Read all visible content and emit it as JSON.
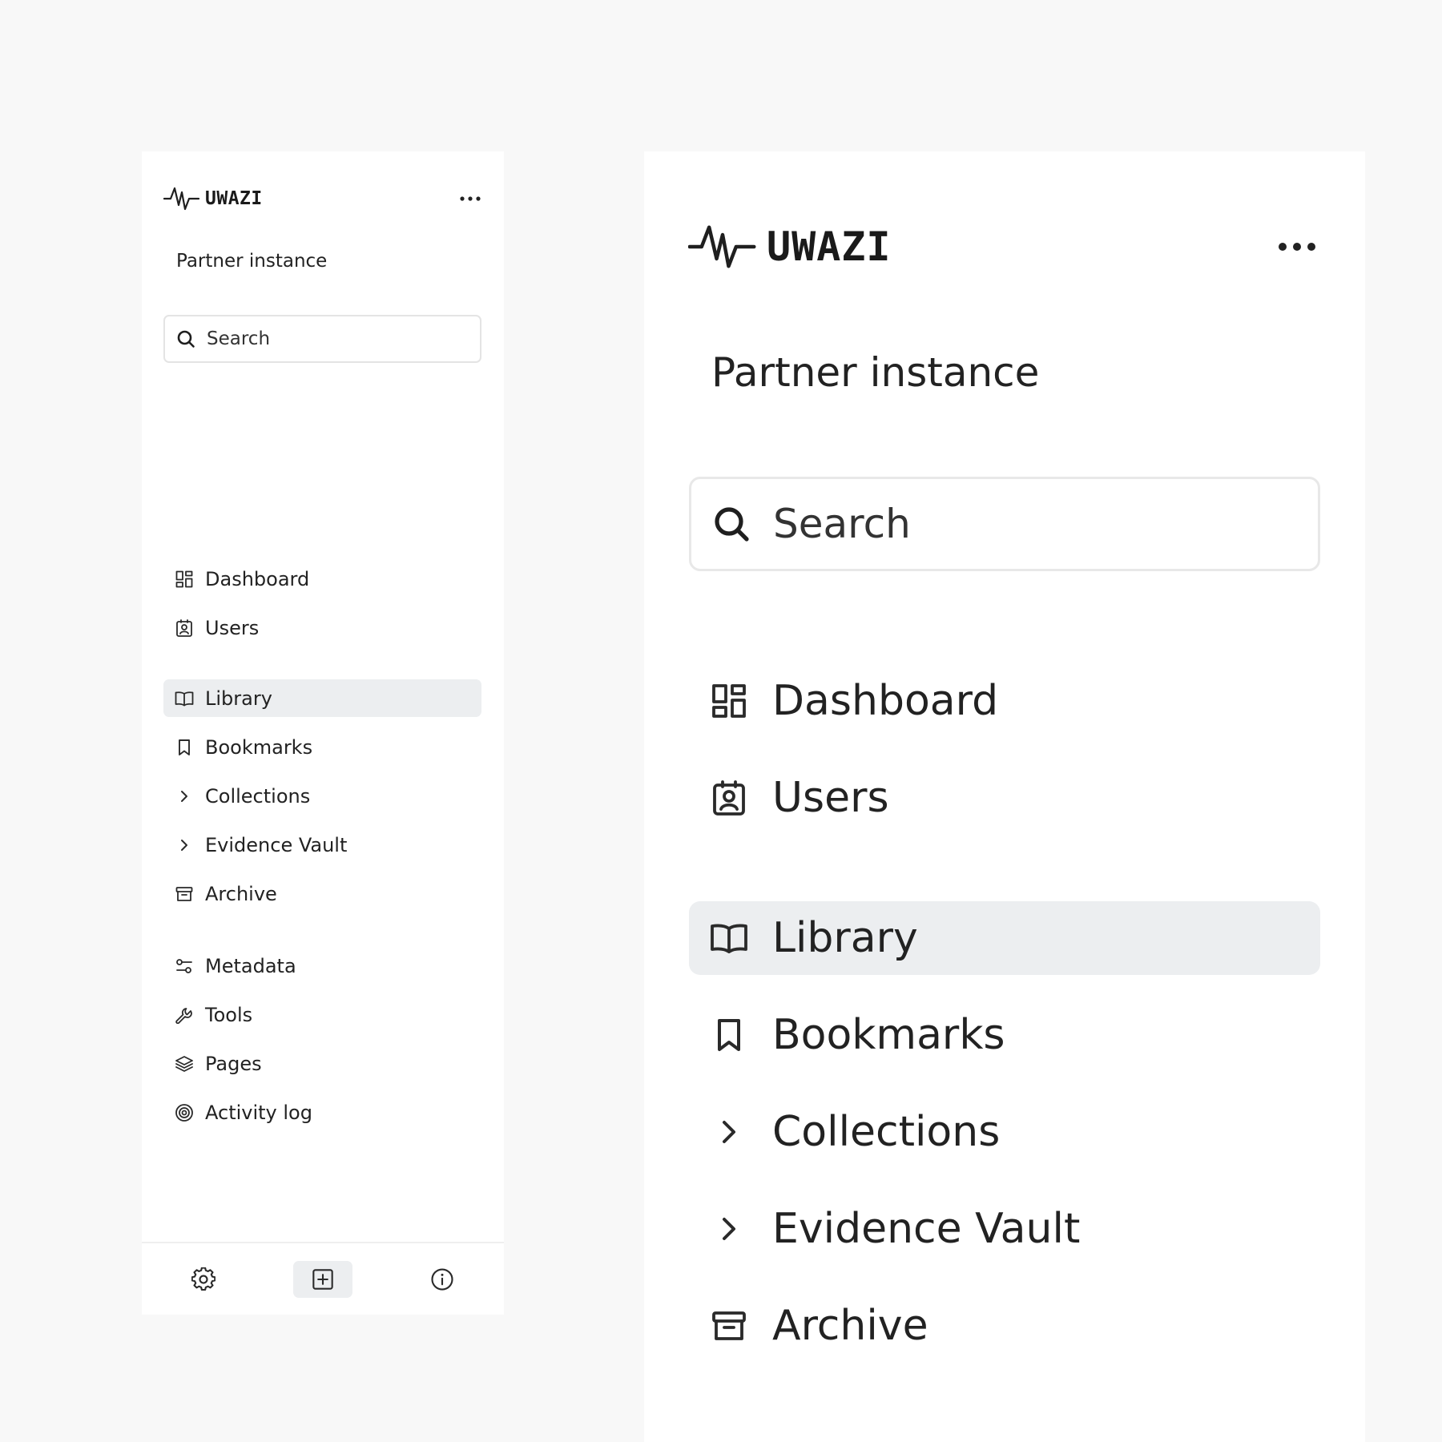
{
  "app": {
    "brand": "UWAZI",
    "instance_name": "Partner instance"
  },
  "search": {
    "placeholder": "Search"
  },
  "nav": {
    "dashboard": "Dashboard",
    "users": "Users",
    "library": "Library",
    "bookmarks": "Bookmarks",
    "collections": "Collections",
    "evidence_vault": "Evidence Vault",
    "archive": "Archive",
    "metadata": "Metadata",
    "tools": "Tools",
    "pages": "Pages",
    "activity_log": "Activity log"
  },
  "active_item": "Library",
  "footer": {
    "icons": [
      "gear-icon",
      "plus-square-icon",
      "info-icon"
    ]
  },
  "colors": {
    "background": "#f8f8f8",
    "panel": "#ffffff",
    "active_bg": "#eceef0",
    "text": "#222222"
  }
}
